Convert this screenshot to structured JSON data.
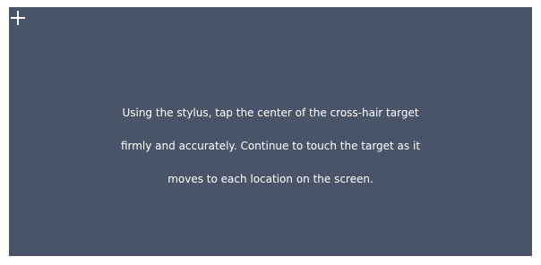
{
  "calibration": {
    "target_icon": "crosshair-icon",
    "background_color": "#4a5469",
    "text_color": "#ffffff",
    "instructions": [
      "Using the stylus, tap the center of the cross-hair target",
      "firmly and accurately. Continue to touch the target as it",
      "moves to each location on the screen."
    ]
  }
}
